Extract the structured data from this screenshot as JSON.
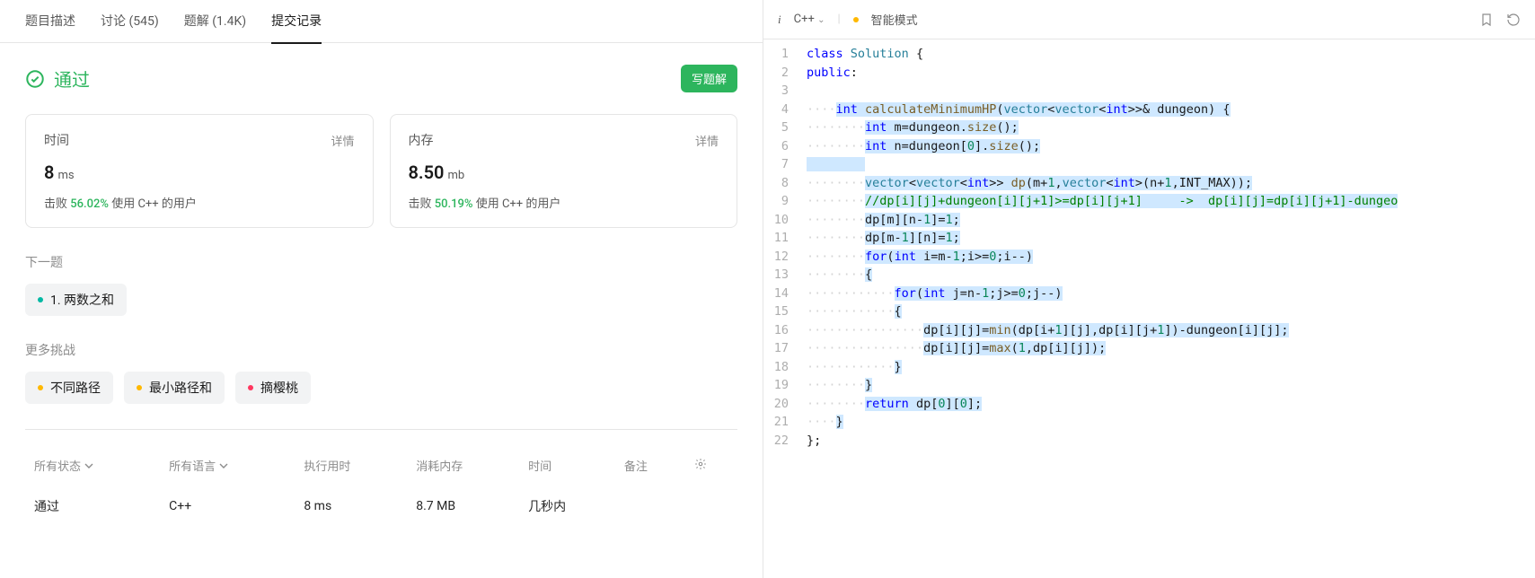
{
  "tabs": {
    "desc": "题目描述",
    "discuss": "讨论 (545)",
    "solutions": "题解 (1.4K)",
    "submissions": "提交记录"
  },
  "result": {
    "status": "通过",
    "write_btn": "写题解"
  },
  "time_card": {
    "title": "时间",
    "detail": "详情",
    "value": "8",
    "unit": "ms",
    "beats_prefix": "击败",
    "beats_pct": "56.02%",
    "beats_suffix": "使用 C++ 的用户"
  },
  "mem_card": {
    "title": "内存",
    "detail": "详情",
    "value": "8.50",
    "unit": "mb",
    "beats_prefix": "击败",
    "beats_pct": "50.19%",
    "beats_suffix": "使用 C++ 的用户"
  },
  "next": {
    "title": "下一题",
    "item": "1. 两数之和"
  },
  "more": {
    "title": "更多挑战",
    "a": "不同路径",
    "b": "最小路径和",
    "c": "摘樱桃"
  },
  "table": {
    "h_status": "所有状态",
    "h_lang": "所有语言",
    "h_runtime": "执行用时",
    "h_memory": "消耗内存",
    "h_time": "时间",
    "h_note": "备注",
    "r_status": "通过",
    "r_lang": "C++",
    "r_runtime": "8 ms",
    "r_memory": "8.7 MB",
    "r_time": "几秒内"
  },
  "editor": {
    "lang": "C++",
    "mode": "智能模式"
  },
  "code_lines": [
    "1",
    "2",
    "3",
    "4",
    "5",
    "6",
    "7",
    "8",
    "9",
    "10",
    "11",
    "12",
    "13",
    "14",
    "15",
    "16",
    "17",
    "18",
    "19",
    "20",
    "21",
    "22"
  ]
}
